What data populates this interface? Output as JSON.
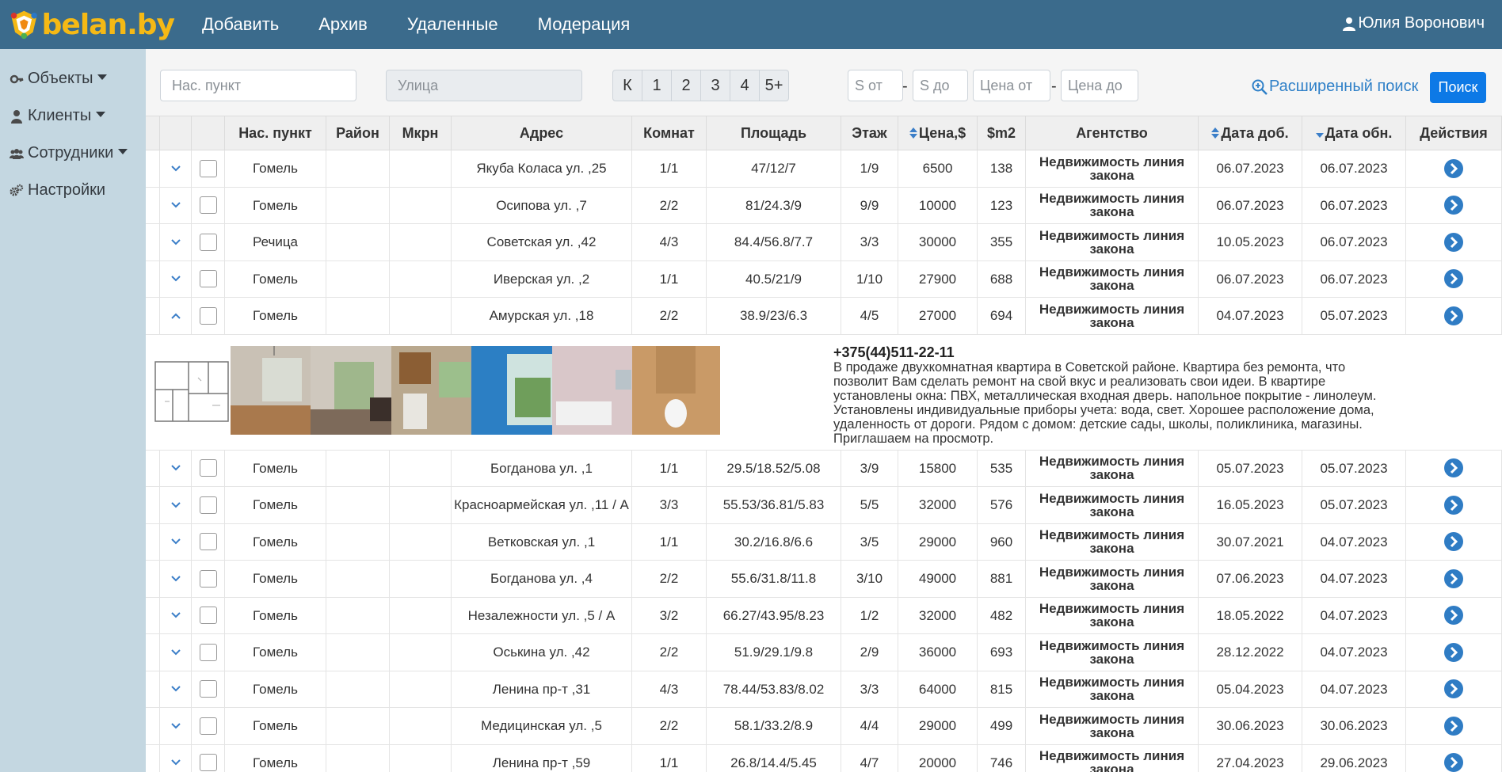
{
  "brand": {
    "name": "belan.by"
  },
  "nav": [
    "Добавить",
    "Архив",
    "Удаленные",
    "Модерация"
  ],
  "user": {
    "name": "Юлия Воронович",
    "icon": "user-icon"
  },
  "sidebar": [
    {
      "label": "Объекты",
      "icon": "key-icon"
    },
    {
      "label": "Клиенты",
      "icon": "user-icon"
    },
    {
      "label": "Сотрудники",
      "icon": "users-icon"
    },
    {
      "label": "Настройки",
      "icon": "gears-icon"
    }
  ],
  "filters": {
    "city_placeholder": "Нас. пункт",
    "street_placeholder": "Улица",
    "rooms": [
      "К",
      "1",
      "2",
      "3",
      "4",
      "5+"
    ],
    "s_from": "S от",
    "s_to": "S до",
    "price_from": "Цена от",
    "price_to": "Цена до",
    "dash": "-",
    "advanced": "Расширенный поиск",
    "search": "Поиск"
  },
  "table": {
    "headers": [
      "",
      "",
      "",
      "Нас. пункт",
      "Район",
      "Мкрн",
      "Адрес",
      "Комнат",
      "Площадь",
      "Этаж",
      "Цена,$",
      "$m2",
      "Агентство",
      "Дата доб.",
      "Дата обн.",
      "Действия"
    ],
    "rows": [
      {
        "city": "Гомель",
        "district": "",
        "mkrn": "",
        "address": "Якуба Коласа ул. ,25",
        "rooms": "1/1",
        "area": "47/12/7",
        "floor": "1/9",
        "price": "6500",
        "m2": "138",
        "agency": "Недвижимость линия закона",
        "added": "06.07.2023",
        "updated": "06.07.2023",
        "expanded": false
      },
      {
        "city": "Гомель",
        "district": "",
        "mkrn": "",
        "address": "Осипова ул. ,7",
        "rooms": "2/2",
        "area": "81/24.3/9",
        "floor": "9/9",
        "price": "10000",
        "m2": "123",
        "agency": "Недвижимость линия закона",
        "added": "06.07.2023",
        "updated": "06.07.2023",
        "expanded": false
      },
      {
        "city": "Речица",
        "district": "",
        "mkrn": "",
        "address": "Советская ул. ,42",
        "rooms": "4/3",
        "area": "84.4/56.8/7.7",
        "floor": "3/3",
        "price": "30000",
        "m2": "355",
        "agency": "Недвижимость линия закона",
        "added": "10.05.2023",
        "updated": "06.07.2023",
        "expanded": false
      },
      {
        "city": "Гомель",
        "district": "",
        "mkrn": "",
        "address": "Иверская ул. ,2",
        "rooms": "1/1",
        "area": "40.5/21/9",
        "floor": "1/10",
        "price": "27900",
        "m2": "688",
        "agency": "Недвижимость линия закона",
        "added": "06.07.2023",
        "updated": "06.07.2023",
        "expanded": false
      },
      {
        "city": "Гомель",
        "district": "",
        "mkrn": "",
        "address": "Амурская ул. ,18",
        "rooms": "2/2",
        "area": "38.9/23/6.3",
        "floor": "4/5",
        "price": "27000",
        "m2": "694",
        "agency": "Недвижимость линия закона",
        "added": "04.07.2023",
        "updated": "05.07.2023",
        "expanded": true
      }
    ],
    "rows_after": [
      {
        "city": "Гомель",
        "district": "",
        "mkrn": "",
        "address": "Богданова ул. ,1",
        "rooms": "1/1",
        "area": "29.5/18.52/5.08",
        "floor": "3/9",
        "price": "15800",
        "m2": "535",
        "agency": "Недвижимость линия закона",
        "added": "05.07.2023",
        "updated": "05.07.2023",
        "expanded": false
      },
      {
        "city": "Гомель",
        "district": "",
        "mkrn": "",
        "address": "Красноармейская ул. ,11 / А",
        "rooms": "3/3",
        "area": "55.53/36.81/5.83",
        "floor": "5/5",
        "price": "32000",
        "m2": "576",
        "agency": "Недвижимость линия закона",
        "added": "16.05.2023",
        "updated": "05.07.2023",
        "expanded": false
      },
      {
        "city": "Гомель",
        "district": "",
        "mkrn": "",
        "address": "Ветковская ул. ,1",
        "rooms": "1/1",
        "area": "30.2/16.8/6.6",
        "floor": "3/5",
        "price": "29000",
        "m2": "960",
        "agency": "Недвижимость линия закона",
        "added": "30.07.2021",
        "updated": "04.07.2023",
        "expanded": false
      },
      {
        "city": "Гомель",
        "district": "",
        "mkrn": "",
        "address": "Богданова ул. ,4",
        "rooms": "2/2",
        "area": "55.6/31.8/11.8",
        "floor": "3/10",
        "price": "49000",
        "m2": "881",
        "agency": "Недвижимость линия закона",
        "added": "07.06.2023",
        "updated": "04.07.2023",
        "expanded": false
      },
      {
        "city": "Гомель",
        "district": "",
        "mkrn": "",
        "address": "Незалежности ул. ,5 / А",
        "rooms": "3/2",
        "area": "66.27/43.95/8.23",
        "floor": "1/2",
        "price": "32000",
        "m2": "482",
        "agency": "Недвижимость линия закона",
        "added": "18.05.2022",
        "updated": "04.07.2023",
        "expanded": false
      },
      {
        "city": "Гомель",
        "district": "",
        "mkrn": "",
        "address": "Оськина ул. ,42",
        "rooms": "2/2",
        "area": "51.9/29.1/9.8",
        "floor": "2/9",
        "price": "36000",
        "m2": "693",
        "agency": "Недвижимость линия закона",
        "added": "28.12.2022",
        "updated": "04.07.2023",
        "expanded": false
      },
      {
        "city": "Гомель",
        "district": "",
        "mkrn": "",
        "address": "Ленина пр-т ,31",
        "rooms": "4/3",
        "area": "78.44/53.83/8.02",
        "floor": "3/3",
        "price": "64000",
        "m2": "815",
        "agency": "Недвижимость линия закона",
        "added": "05.04.2023",
        "updated": "04.07.2023",
        "expanded": false
      },
      {
        "city": "Гомель",
        "district": "",
        "mkrn": "",
        "address": "Медицинская ул. ,5",
        "rooms": "2/2",
        "area": "58.1/33.2/8.9",
        "floor": "4/4",
        "price": "29000",
        "m2": "499",
        "agency": "Недвижимость линия закона",
        "added": "30.06.2023",
        "updated": "30.06.2023",
        "expanded": false
      },
      {
        "city": "Гомель",
        "district": "",
        "mkrn": "",
        "address": "Ленина пр-т ,59",
        "rooms": "1/1",
        "area": "26.8/14.4/5.45",
        "floor": "4/7",
        "price": "20000",
        "m2": "746",
        "agency": "Недвижимость линия закона",
        "added": "27.04.2023",
        "updated": "29.06.2023",
        "expanded": false
      }
    ],
    "detail": {
      "phone": "+375(44)511-22-11",
      "description": "В продаже двухкомнатная квартира в Советской районе. Квартира без ремонта, что позволит Вам сделать ремонт на свой вкус и реализовать свои идеи. В квартире установлены окна: ПВХ, металлическая входная дверь. напольное покрытие - линолеум. Установлены индивидуальные приборы учета: вода, свет. Хорошее расположение дома, удаленность от дороги. Рядом с домом: детские сады, школы, поликлиника, магазины. Приглашаем на просмотр.",
      "photos": [
        "floor-plan",
        "room-photo",
        "room-photo",
        "kitchen-photo",
        "balcony-photo",
        "bathroom-photo",
        "toilet-photo"
      ]
    }
  },
  "colors": {
    "topbar": "#3b6b8c",
    "sidebar": "#c4d7e1",
    "accent": "#2f80c8",
    "logo": "#f5b915",
    "search_btn": "#0d79e6"
  }
}
